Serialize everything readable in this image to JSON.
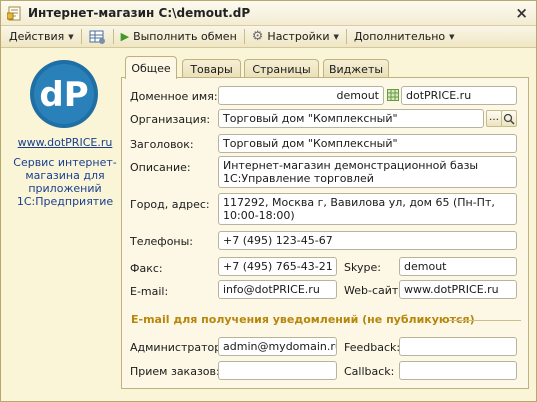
{
  "window": {
    "title": "Интернет-магазин C:\\demout.dP",
    "close_label": "×"
  },
  "toolbar": {
    "actions_label": "Действия",
    "run_exchange_label": "Выполнить обмен",
    "settings_label": "Настройки",
    "more_label": "Дополнительно"
  },
  "sidebar": {
    "site_link": "www.dotPRICE.ru",
    "description": "Сервис интернет-магазина для приложений 1С:Предприятие"
  },
  "tabs": [
    {
      "label": "Общее",
      "active": true
    },
    {
      "label": "Товары",
      "active": false
    },
    {
      "label": "Страницы",
      "active": false
    },
    {
      "label": "Виджеты",
      "active": false
    }
  ],
  "form": {
    "domain": {
      "label": "Доменное имя:",
      "value": "demout",
      "suffix": "dotPRICE.ru"
    },
    "organization": {
      "label": "Организация:",
      "value": "Торговый дом \"Комплексный\""
    },
    "header": {
      "label": "Заголовок:",
      "value": "Торговый дом \"Комплексный\""
    },
    "description": {
      "label": "Описание:",
      "value": "Интернет-магазин демонстрационной базы 1С:Управление торговлей"
    },
    "address": {
      "label": "Город, адрес:",
      "value": "117292, Москва г, Вавилова ул, дом 65 (Пн-Пт, 10:00-18:00)"
    },
    "phones": {
      "label": "Телефоны:",
      "value": "+7 (495) 123-45-67"
    },
    "fax": {
      "label": "Факс:",
      "value": "+7 (495) 765-43-21"
    },
    "skype": {
      "label": "Skype:",
      "value": "demout"
    },
    "email": {
      "label": "E-mail:",
      "value": "info@dotPRICE.ru"
    },
    "website": {
      "label": "Web-сайт:",
      "value": "www.dotPRICE.ru"
    },
    "notify_section_title": "E-mail для получения уведомлений (не публикуются)",
    "admin": {
      "label": "Администратор:",
      "value": "admin@mydomain.ru"
    },
    "feedback": {
      "label": "Feedback:",
      "value": ""
    },
    "orders": {
      "label": "Прием заказов:",
      "value": ""
    },
    "callback": {
      "label": "Callback:",
      "value": ""
    }
  },
  "colors": {
    "window_bg": "#fbf5d8",
    "link": "#1a3f8f",
    "section_title": "#b8860b",
    "logo_blue": "#1f6fa4"
  },
  "icons": {
    "title": "document-icon",
    "actions_icon": "table-icon",
    "run": "play-icon",
    "settings": "gear-icon",
    "domain_sep": "grid-icon",
    "select": "ellipsis-icon",
    "open": "magnifier-icon"
  },
  "logo_text": "dP"
}
